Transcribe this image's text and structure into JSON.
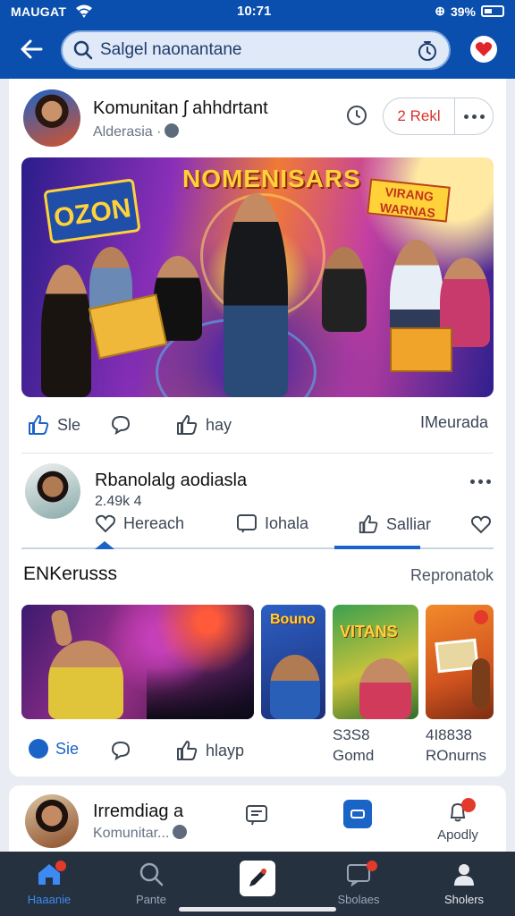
{
  "status_bar": {
    "carrier": "MAUGAT",
    "time": "10:71",
    "battery": "39%"
  },
  "header": {
    "search_placeholder": "Salgel naonantane"
  },
  "post1": {
    "author": "Komunitan ʃ ahhdrtant",
    "subtitle": "Alderasia ·",
    "follow_label": "2 Rekl",
    "hero": {
      "headline": "NOMENISARS",
      "left_banner": "OZON",
      "right_banner": "VIRANG WARNAS"
    },
    "actions": {
      "like": "Sle",
      "share": "hay",
      "right": "IMeurada"
    }
  },
  "post2": {
    "author": "Rbanolalg aodiasla",
    "meta": "2.49k 4",
    "tabs": {
      "reactions": "Hereach",
      "comments": "Iohala",
      "saves": "Salliar"
    }
  },
  "section": {
    "title": "ENKerusss",
    "more": "Repronatok",
    "tiles": [
      {
        "label": ""
      },
      {
        "label": "Bouno"
      },
      {
        "label": "VITANS"
      },
      {
        "label": ""
      }
    ],
    "actions": {
      "like": "Sie",
      "share": "hlayp"
    },
    "stats": [
      {
        "value": "S3S8",
        "label": "Gomd"
      },
      {
        "value": "4I8838",
        "label": "ROnurns"
      }
    ]
  },
  "post3": {
    "author": "Irremdiag a",
    "subtitle": "Komunitar...",
    "action_label": "Apodly"
  },
  "bottom_nav": [
    {
      "label": "Haaanie",
      "icon": "home-icon"
    },
    {
      "label": "Pante",
      "icon": "search-icon"
    },
    {
      "label": "",
      "icon": "create-post-icon"
    },
    {
      "label": "Sbolaes",
      "icon": "messages-icon"
    },
    {
      "label": "Sholers",
      "icon": "profile-icon"
    }
  ],
  "colors": {
    "brand": "#0a4fae",
    "accent": "#1a64c8",
    "nav_bg": "#25313f",
    "alert": "#e33a2c"
  }
}
